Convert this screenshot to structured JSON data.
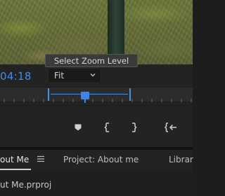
{
  "program_monitor": {
    "timecode": "04:18",
    "zoom": {
      "tooltip": "Select Zoom Level",
      "selected": "Fit"
    },
    "controls": [
      {
        "name": "add-marker",
        "icon": "marker-icon"
      },
      {
        "name": "mark-in",
        "icon": "mark-in-icon"
      },
      {
        "name": "mark-out",
        "icon": "mark-out-icon"
      },
      {
        "name": "go-to-in",
        "icon": "go-to-in-icon"
      }
    ],
    "accent_color": "#3b8cf0"
  },
  "panel_tabs": {
    "tab1": "out Me",
    "tab2": "Project: About me",
    "tab3": "Librar"
  },
  "project_panel": {
    "file_name": "ut Me.prproj"
  }
}
